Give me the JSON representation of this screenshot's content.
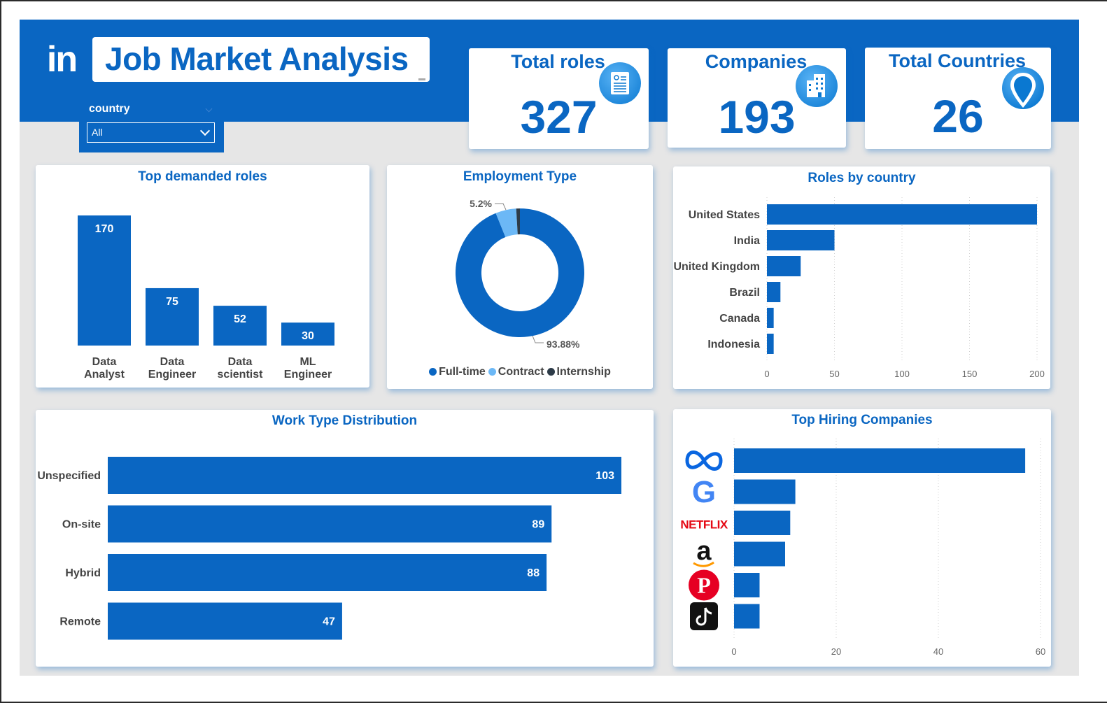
{
  "header": {
    "logo_text": "in",
    "title": "Job Market Analysis"
  },
  "slicer": {
    "label": "country",
    "value": "All"
  },
  "kpis": [
    {
      "title": "Total roles",
      "value": "327",
      "icon": "document-icon"
    },
    {
      "title": "Companies",
      "value": "193",
      "icon": "building-icon"
    },
    {
      "title": "Total Countries",
      "value": "26",
      "icon": "location-pin-icon"
    }
  ],
  "colors": {
    "primary": "#0a66c2",
    "light": "#6cb8f6",
    "dark": "#2d3b48",
    "background": "#e6e6e6"
  },
  "chart_data": [
    {
      "id": "top_roles",
      "type": "bar",
      "title": "Top demanded roles",
      "categories": [
        [
          "Data",
          "Analyst"
        ],
        [
          "Data",
          "Engineer"
        ],
        [
          "Data",
          "scientist"
        ],
        [
          "ML",
          "Engineer"
        ]
      ],
      "values": [
        170,
        75,
        52,
        30
      ],
      "ylim": [
        0,
        170
      ]
    },
    {
      "id": "employment_type",
      "type": "pie",
      "title": "Employment Type",
      "categories": [
        "Full-time",
        "Contract",
        "Internship"
      ],
      "values": [
        93.88,
        5.2,
        0.92
      ],
      "labels": {
        "Full-time": "93.88%",
        "Contract": "5.2%"
      },
      "colors": [
        "#0a66c2",
        "#6cb8f6",
        "#2d3b48"
      ]
    },
    {
      "id": "roles_by_country",
      "type": "bar",
      "orientation": "horizontal",
      "title": "Roles by country",
      "categories": [
        "United States",
        "India",
        "United Kingdom",
        "Brazil",
        "Canada",
        "Indonesia"
      ],
      "values": [
        200,
        50,
        25,
        10,
        5,
        5
      ],
      "xlim": [
        0,
        200
      ],
      "xticks": [
        0,
        50,
        100,
        150,
        200
      ]
    },
    {
      "id": "work_type",
      "type": "bar",
      "orientation": "horizontal",
      "title": "Work Type Distribution",
      "categories": [
        "Unspecified",
        "On-site",
        "Hybrid",
        "Remote"
      ],
      "values": [
        103,
        89,
        88,
        47
      ],
      "xlim": [
        0,
        103
      ]
    },
    {
      "id": "top_hiring",
      "type": "bar",
      "orientation": "horizontal",
      "title": "Top Hiring Companies",
      "categories": [
        "meta-logo",
        "google-logo",
        "netflix-logo",
        "amazon-logo",
        "pinterest-logo",
        "tiktok-logo"
      ],
      "logo_text": {
        "netflix-logo": "NETFLIX",
        "google-logo": "G",
        "amazon-logo": "a",
        "pinterest-logo": "P"
      },
      "values": [
        57,
        12,
        11,
        10,
        5,
        5
      ],
      "xlim": [
        0,
        60
      ],
      "xticks": [
        0,
        20,
        40,
        60
      ]
    }
  ]
}
